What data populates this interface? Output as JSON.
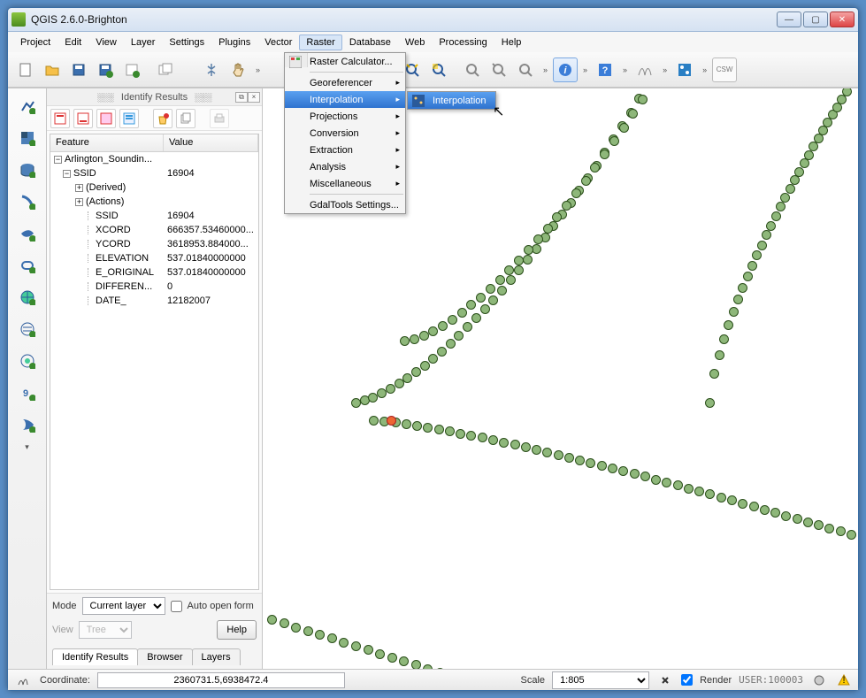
{
  "title": "QGIS 2.6.0-Brighton",
  "menubar": [
    "Project",
    "Edit",
    "View",
    "Layer",
    "Settings",
    "Plugins",
    "Vector",
    "Raster",
    "Database",
    "Web",
    "Processing",
    "Help"
  ],
  "active_menu_index": 7,
  "raster_menu": {
    "items": [
      {
        "label": "Raster Calculator...",
        "sub": false
      },
      {
        "label": "Georeferencer",
        "sub": true
      },
      {
        "label": "Interpolation",
        "sub": true,
        "highlight": true
      },
      {
        "label": "Projections",
        "sub": true
      },
      {
        "label": "Conversion",
        "sub": true
      },
      {
        "label": "Extraction",
        "sub": true
      },
      {
        "label": "Analysis",
        "sub": true
      },
      {
        "label": "Miscellaneous",
        "sub": true
      },
      {
        "label": "GdalTools Settings...",
        "sub": false
      }
    ],
    "submenu_label": "Interpolation"
  },
  "identify": {
    "title": "Identify Results",
    "headers": {
      "feature": "Feature",
      "value": "Value"
    },
    "root": "Arlington_Soundin...",
    "rows": [
      {
        "k": "SSID",
        "v": "16904",
        "ind": 1,
        "exp": "-"
      },
      {
        "k": "(Derived)",
        "v": "",
        "ind": 2,
        "exp": "+"
      },
      {
        "k": "(Actions)",
        "v": "",
        "ind": 2,
        "exp": "+"
      },
      {
        "k": "SSID",
        "v": "16904",
        "ind": 3
      },
      {
        "k": "XCORD",
        "v": "666357.53460000...",
        "ind": 3
      },
      {
        "k": "YCORD",
        "v": "3618953.884000...",
        "ind": 3
      },
      {
        "k": "ELEVATION",
        "v": "537.01840000000",
        "ind": 3
      },
      {
        "k": "E_ORIGINAL",
        "v": "537.01840000000",
        "ind": 3
      },
      {
        "k": "DIFFEREN...",
        "v": "0",
        "ind": 3
      },
      {
        "k": "DATE_",
        "v": "12182007",
        "ind": 3
      }
    ],
    "mode_label": "Mode",
    "mode_value": "Current layer",
    "auto_open": "Auto open form",
    "view_label": "View",
    "view_value": "Tree",
    "help": "Help",
    "tabs": [
      "Identify Results",
      "Browser",
      "Layers"
    ]
  },
  "status": {
    "coord_label": "Coordinate:",
    "coord_value": "2360731.5,6938472.4",
    "scale_label": "Scale",
    "scale_value": "1:805",
    "render": "Render",
    "user": "USER:100003"
  },
  "icons": {
    "csw": "CSW"
  }
}
